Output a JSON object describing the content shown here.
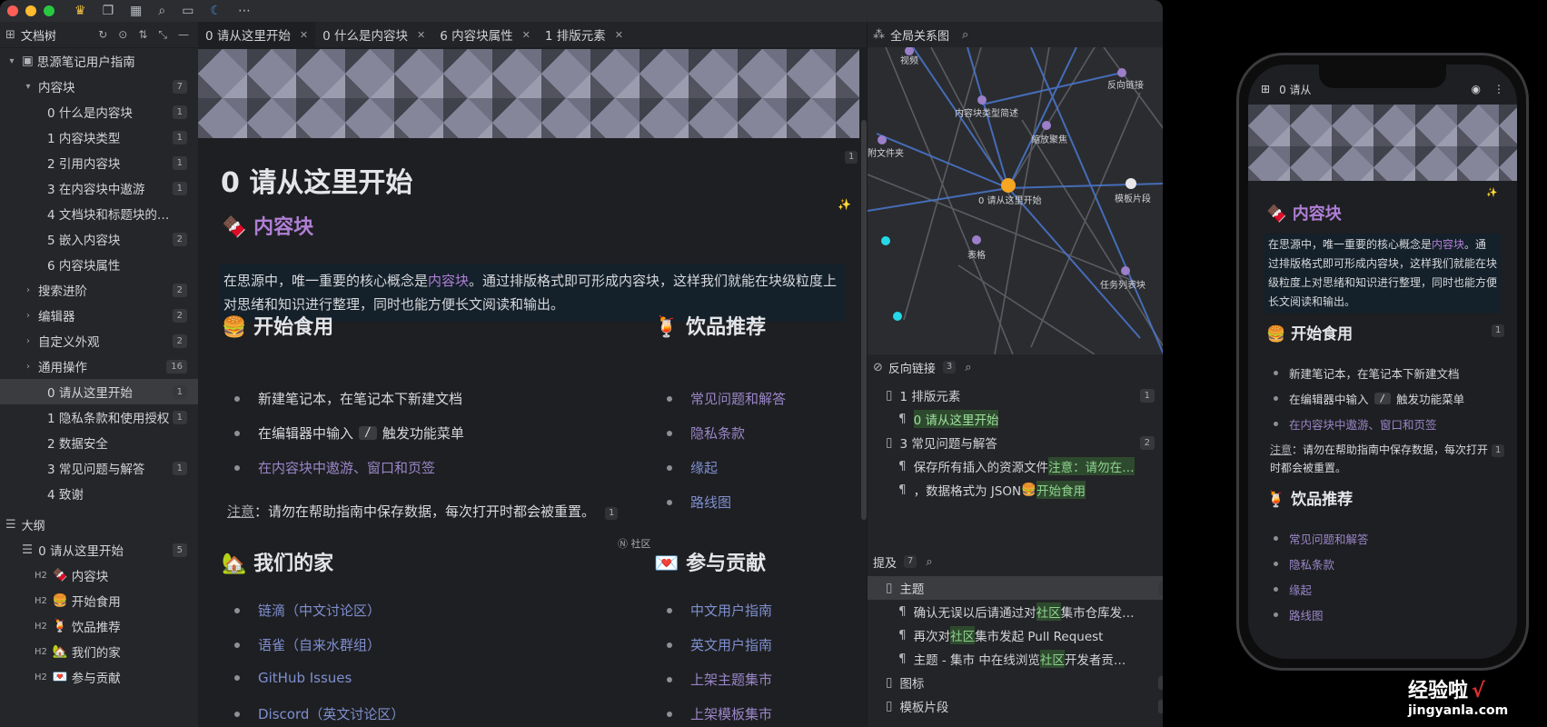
{
  "toolbar": {
    "icons": [
      "crown-icon",
      "copy-icon",
      "calendar-icon",
      "search-icon",
      "window-icon",
      "moon-icon",
      "more-icon"
    ]
  },
  "doc_tree": {
    "title": "文档树",
    "notebook": "思源笔记用户指南",
    "items": [
      {
        "label": "内容块",
        "count": "7",
        "level": 1,
        "expanded": true
      },
      {
        "label": "0 什么是内容块",
        "count": "1",
        "level": 2
      },
      {
        "label": "1 内容块类型",
        "count": "1",
        "level": 2
      },
      {
        "label": "2 引用内容块",
        "count": "1",
        "level": 2
      },
      {
        "label": "3 在内容块中遨游",
        "count": "1",
        "level": 2
      },
      {
        "label": "4 文档块和标题块的…",
        "count": "",
        "level": 2
      },
      {
        "label": "5 嵌入内容块",
        "count": "2",
        "level": 2
      },
      {
        "label": "6 内容块属性",
        "count": "",
        "level": 2
      },
      {
        "label": "搜索进阶",
        "count": "2",
        "level": 1
      },
      {
        "label": "编辑器",
        "count": "2",
        "level": 1
      },
      {
        "label": "自定义外观",
        "count": "2",
        "level": 1
      },
      {
        "label": "通用操作",
        "count": "16",
        "level": 1
      },
      {
        "label": "0 请从这里开始",
        "count": "1",
        "level": 1,
        "active": true
      },
      {
        "label": "1 隐私条款和使用授权",
        "count": "1",
        "level": 1
      },
      {
        "label": "2 数据安全",
        "count": "",
        "level": 1
      },
      {
        "label": "3 常见问题与解答",
        "count": "1",
        "level": 1
      },
      {
        "label": "4 致谢",
        "count": "",
        "level": 1
      }
    ]
  },
  "outline": {
    "title": "大纲",
    "doc": "0 请从这里开始",
    "doc_count": "5",
    "headings": [
      {
        "tag": "H2",
        "emoji": "🍫",
        "label": "内容块"
      },
      {
        "tag": "H2",
        "emoji": "🍔",
        "label": "开始食用"
      },
      {
        "tag": "H2",
        "emoji": "🍹",
        "label": "饮品推荐"
      },
      {
        "tag": "H2",
        "emoji": "🏡",
        "label": "我们的家"
      },
      {
        "tag": "H2",
        "emoji": "💌",
        "label": "参与贡献"
      }
    ]
  },
  "tabs": [
    {
      "label": "0 请从这里开始",
      "active": true
    },
    {
      "label": "0 什么是内容块"
    },
    {
      "label": "6 内容块属性"
    },
    {
      "label": "1 排版元素"
    }
  ],
  "editor": {
    "title": "0 请从这里开始",
    "title_badge": "1",
    "sparkle": "✨",
    "section_blocks": {
      "emoji": "🍫",
      "heading": "内容块"
    },
    "intro": {
      "before": "在思源中，唯一重要的核心概念是",
      "link": "内容块",
      "after": "。通过排版格式即可形成内容块，这样我们就能在块级粒度上对思绪和知识进行整理，同时也能方便长文阅读和输出。"
    },
    "start": {
      "emoji": "🍔",
      "heading": "开始食用",
      "items": [
        "新建笔记本，在笔记本下新建文档"
      ],
      "editor_item_before": "在编辑器中输入",
      "editor_item_key": "/",
      "editor_item_after": "触发功能菜单",
      "link_a": "在内容块中遨游",
      "link_sep": "、",
      "link_b": "窗口和页签"
    },
    "note": {
      "label": "注意",
      "text": "：请勿在帮助指南中保存数据，每次打开时都会被重置。",
      "badge": "1"
    },
    "drinks": {
      "emoji": "🍹",
      "heading": "饮品推荐",
      "items": [
        "常见问题和解答",
        "隐私条款",
        "缘起",
        "路线图"
      ]
    },
    "community_tag": "Ⓝ 社区",
    "home": {
      "emoji": "🏡",
      "heading": "我们的家",
      "items": [
        "链滴（中文讨论区）",
        "语雀（自来水群组）",
        "GitHub Issues",
        "Discord（英文讨论区）"
      ]
    },
    "contribute": {
      "emoji": "💌",
      "heading": "参与贡献",
      "items": [
        "中文用户指南",
        "英文用户指南",
        "上架主题集市",
        "上架模板集市"
      ]
    }
  },
  "graph": {
    "title": "全局关系图",
    "labels": [
      "视频",
      "反向链接",
      "内容块类型简述",
      "缩放聚焦",
      "附文件夹",
      "0 请从这里开始",
      "模板片段",
      "表格",
      "任务列表块"
    ],
    "colors": {
      "node": "#9b7fc9",
      "center": "#f5a623",
      "cyan": "#25d8e6",
      "edge_blue": "#4a78d0",
      "edge_gray": "#6b6d73"
    }
  },
  "backlinks": {
    "title": "反向链接",
    "count": "3",
    "items": [
      {
        "kind": "doc",
        "label": "1 排版元素",
        "count": "1"
      },
      {
        "kind": "para",
        "label": "0 请从这里开始",
        "highlight": true
      },
      {
        "kind": "doc",
        "label": "3 常见问题与解答",
        "count": "2"
      },
      {
        "kind": "para",
        "label_before": "保存所有插入的资源文件",
        "label_hl": "注意：请勿在…"
      },
      {
        "kind": "para",
        "label_before": "，数据格式为 JSON",
        "label_emoji": "🍔",
        "label_hl": "开始食用"
      }
    ]
  },
  "mentions": {
    "title": "提及",
    "count": "7",
    "items": [
      {
        "kind": "doc",
        "label": "主题",
        "count": "3",
        "active": true
      },
      {
        "kind": "para",
        "before": "确认无误以后请通过对",
        "hl": "社区",
        "after": "集市仓库发…"
      },
      {
        "kind": "para",
        "before": "再次对",
        "hl": "社区",
        "after": "集市发起 Pull Request"
      },
      {
        "kind": "para",
        "before": "主题 - 集市 中在线浏览",
        "hl": "社区",
        "after": "开发者贡…"
      },
      {
        "kind": "doc",
        "label": "图标",
        "count": "2"
      },
      {
        "kind": "doc",
        "label": "模板片段",
        "count": "2"
      }
    ]
  },
  "phone": {
    "tab_label": "0 请从",
    "section_blocks": {
      "emoji": "🍫",
      "heading": "内容块"
    },
    "intro_before": "在思源中，唯一重要的核心概念是",
    "intro_link": "内容块",
    "intro_after": "。通过排版格式即可形成内容块，这样我们就能在块级粒度上对思绪和知识进行整理，同时也能方便长文阅读和输出。",
    "start_heading": "开始食用",
    "start_items": [
      "新建笔记本，在笔记本下新建文档"
    ],
    "editor_before": "在编辑器中输入",
    "editor_key": "/",
    "editor_after": "触发功能菜单",
    "link_a": "在内容块中遨游",
    "link_sep": "、",
    "link_b": "窗口和页签",
    "note_label": "注意",
    "note_text": "：请勿在帮助指南中保存数据，每次打开时都会被重置。",
    "drinks_heading": "饮品推荐",
    "drinks_items": [
      "常见问题和解答",
      "隐私条款",
      "缘起",
      "路线图"
    ],
    "badge": "1"
  },
  "watermark": {
    "line1": "经验啦",
    "check": "√",
    "line2": "jingyanla.com"
  }
}
